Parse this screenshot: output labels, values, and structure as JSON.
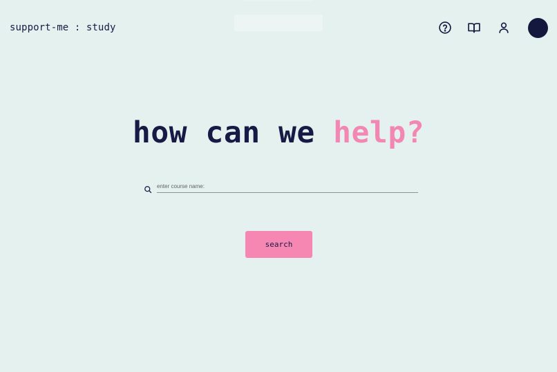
{
  "header": {
    "brand": "support-me : study",
    "nav": [
      {
        "icon": "help-circle-icon",
        "label": ""
      },
      {
        "icon": "book-icon",
        "label": ""
      },
      {
        "icon": "user-icon",
        "label": ""
      }
    ],
    "avatar_color": "#14183f"
  },
  "hero": {
    "headline_main": "how can we ",
    "headline_accent": "help?"
  },
  "search": {
    "placeholder": "enter course name:",
    "value": "",
    "icon": "search-icon",
    "button_label": "search"
  },
  "colors": {
    "background": "#e5f1ee",
    "text": "#161a45",
    "accent": "#f687b3"
  }
}
